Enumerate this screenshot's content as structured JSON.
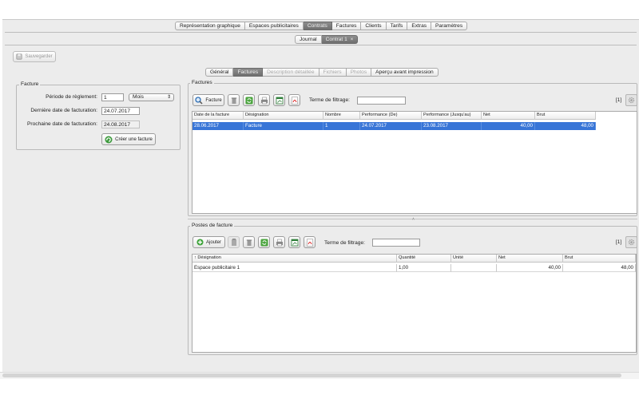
{
  "main_tabs": [
    {
      "label": "Représentation graphique",
      "active": false
    },
    {
      "label": "Espaces publicitaires",
      "active": false
    },
    {
      "label": "Contrats",
      "active": true
    },
    {
      "label": "Factures",
      "active": false
    },
    {
      "label": "Clients",
      "active": false
    },
    {
      "label": "Tarifs",
      "active": false
    },
    {
      "label": "Extras",
      "active": false
    },
    {
      "label": "Paramètres",
      "active": false
    }
  ],
  "doc_tabs": {
    "journal": "Journal",
    "contract": "Contrat 1",
    "close": "×"
  },
  "toolbar": {
    "save_label": "Sauvegarder"
  },
  "sub_tabs": [
    {
      "label": "Général",
      "state": "normal"
    },
    {
      "label": "Factures",
      "state": "active"
    },
    {
      "label": "Description détaillée",
      "state": "disabled"
    },
    {
      "label": "Fichiers",
      "state": "disabled"
    },
    {
      "label": "Photos",
      "state": "disabled"
    },
    {
      "label": "Aperçu avant impression",
      "state": "normal"
    }
  ],
  "facture_panel": {
    "title": "Facture",
    "period_label": "Période de règlement:",
    "period_value": "1",
    "period_unit": "Mois",
    "last_label": "Dernière date de facturation:",
    "last_value": "24.07.2017",
    "next_label": "Prochaine date de facturation:",
    "next_value": "24.08.2017",
    "create_button": "Créer une facture"
  },
  "factures": {
    "title": "Factures",
    "button_label": "Facture",
    "filter_label": "Terme de filtrage:",
    "filter_value": "",
    "count": "[1]",
    "columns": [
      "Date de la facture",
      "Désignation",
      "Nombre",
      "Performance (De)",
      "Performance (Jusqu'au)",
      "Net",
      "Brut"
    ],
    "rows": [
      [
        "28.06.2017",
        "Facture",
        "1",
        "24.07.2017",
        "23.08.2017",
        "40,00",
        "48,00"
      ]
    ]
  },
  "postes": {
    "title": "Postes de facture",
    "add_label": "Ajouter",
    "filter_label": "Terme de filtrage:",
    "filter_value": "",
    "count": "[1]",
    "columns": [
      "↑ Désignation",
      "Quantité",
      "Unité",
      "Net",
      "Brut"
    ],
    "rows": [
      [
        "Espace publicitaire 1",
        "1,00",
        "",
        "40,00",
        "48,00"
      ]
    ]
  },
  "colors": {
    "selection": "#3875d7",
    "active_tab": "#7a7a7a",
    "window_bg": "#ececec"
  }
}
